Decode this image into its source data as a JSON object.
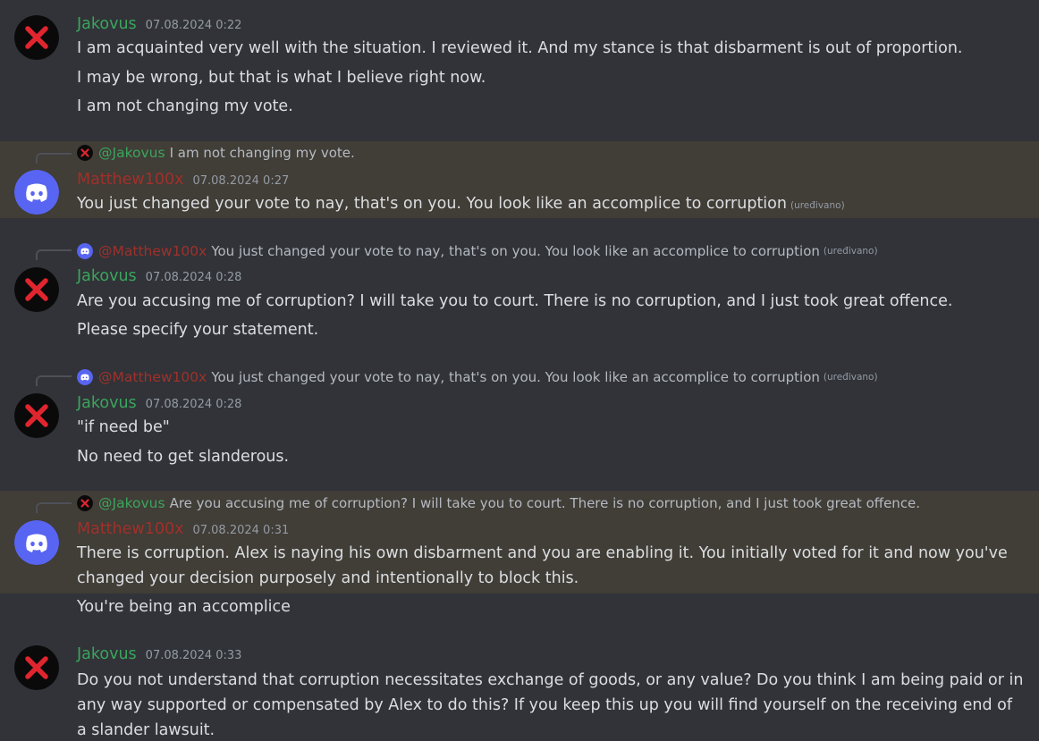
{
  "users": {
    "jakovus": {
      "name": "Jakovus",
      "color": "#3ba55d",
      "avatar_icon": "red-x-avatar-icon",
      "mention": "@Jakovus"
    },
    "matthew": {
      "name": "Matthew100x",
      "color": "#a0302a",
      "avatar_icon": "discord-logo-avatar-icon",
      "mention": "@Matthew100x"
    }
  },
  "colors": {
    "background": "#313338",
    "highlight": "#413d37",
    "text": "#dbdee1",
    "muted": "#949ba4",
    "discord_blurple": "#5865f2",
    "x_red": "#e0252f"
  },
  "messages": [
    {
      "author": "Jakovus",
      "timestamp": "07.08.2024 0:22",
      "lines": [
        "I am acquainted very well with the situation. I reviewed it. And my stance is that disbarment is out of proportion.",
        "I may be wrong, but that is what I believe right now.",
        "I am not changing my vote."
      ]
    },
    {
      "author": "Matthew100x",
      "timestamp": "07.08.2024 0:27",
      "reply_to": {
        "author": "@Jakovus",
        "text": "I am not changing my vote."
      },
      "lines": [
        "You just changed your vote to nay, that's on you. You look like an accomplice to corruption"
      ],
      "edited": "(uređivano)"
    },
    {
      "author": "Jakovus",
      "timestamp": "07.08.2024 0:28",
      "reply_to": {
        "author": "@Matthew100x",
        "text": "You just changed your vote to nay, that's on you. You look like an accomplice to corruption",
        "edited": "(uređivano)"
      },
      "lines": [
        "Are you accusing me of corruption? I will take you to court. There is no corruption, and I just took great offence.",
        "Please specify your statement."
      ]
    },
    {
      "author": "Jakovus",
      "timestamp": "07.08.2024 0:28",
      "reply_to": {
        "author": "@Matthew100x",
        "text": "You just changed your vote to nay, that's on you. You look like an accomplice to corruption",
        "edited": "(uređivano)"
      },
      "lines": [
        "\"if need be\"",
        "No need to get slanderous."
      ]
    },
    {
      "author": "Matthew100x",
      "timestamp": "07.08.2024 0:31",
      "reply_to": {
        "author": "@Jakovus",
        "text": "Are you accusing me of corruption? I will take you to court. There is no corruption, and I just took great offence."
      },
      "lines": [
        "There is corruption. Alex is naying his own disbarment and you are enabling it. You initially voted for it and now you've changed your decision purposely and intentionally to block this.",
        "You're being an accomplice"
      ]
    },
    {
      "author": "Jakovus",
      "timestamp": "07.08.2024 0:33",
      "lines": [
        "Do you not understand that corruption necessitates exchange of goods, or any value? Do you think I am being paid or in any way supported or compensated by Alex to do this? If you keep this up you will find yourself on the receiving end of a slander lawsuit."
      ]
    }
  ]
}
